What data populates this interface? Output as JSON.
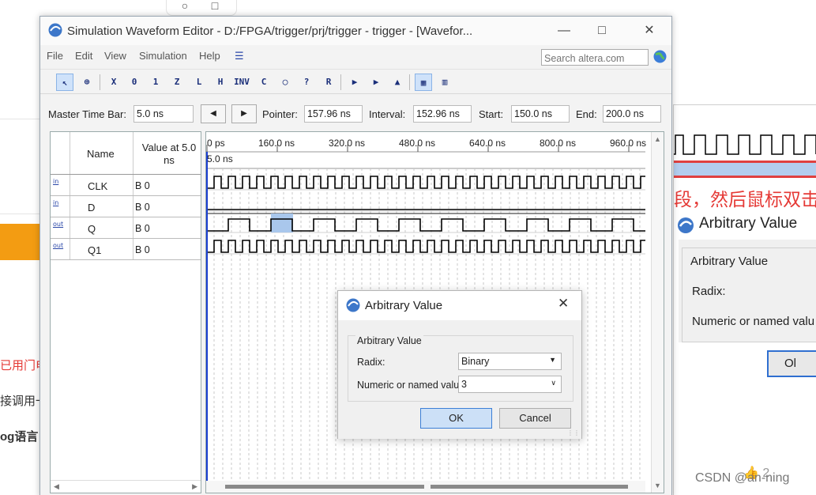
{
  "background": {
    "texts": [
      {
        "text": "已用门电",
        "red": true,
        "bold": false
      },
      {
        "text": "接调用一",
        "red": false,
        "bold": false
      },
      {
        "text": "og语言",
        "red": false,
        "bold": true
      }
    ],
    "right_window": {
      "cn_text": "段，然后鼠标双击",
      "dialog_title": "Arbitrary Value",
      "group_title": "Arbitrary Value",
      "radix_label": "Radix:",
      "value_label": "Numeric or named valu",
      "ok_partial": "Ol",
      "thumb_count": "2"
    },
    "watermark": "CSDN @an-ning"
  },
  "window": {
    "title": "Simulation Waveform Editor - D:/FPGA/trigger/prj/trigger - trigger - [Wavefor...",
    "menu": [
      "File",
      "Edit",
      "View",
      "Simulation",
      "Help"
    ],
    "search_placeholder": "Search altera.com"
  },
  "timebar": {
    "master_label": "Master Time Bar:",
    "master_value": "5.0 ns",
    "pointer_label": "Pointer:",
    "pointer_value": "157.96 ns",
    "interval_label": "Interval:",
    "interval_value": "152.96 ns",
    "start_label": "Start:",
    "start_value": "150.0 ns",
    "end_label": "End:",
    "end_value": "200.0 ns"
  },
  "signals": {
    "header_name": "Name",
    "header_value": "Value at 5.0 ns",
    "rows": [
      {
        "dir": "in",
        "name": "CLK",
        "value": "B 0"
      },
      {
        "dir": "in",
        "name": "D",
        "value": "B 0"
      },
      {
        "dir": "out",
        "name": "Q",
        "value": "B 0"
      },
      {
        "dir": "out",
        "name": "Q1",
        "value": "B 0"
      }
    ]
  },
  "waveform": {
    "time_ticks": [
      "0 ps",
      "160.0 ns",
      "320.0 ns",
      "480.0 ns",
      "640.0 ns",
      "800.0 ns",
      "960.0 ns"
    ],
    "cursor_label": "5.0 ns"
  },
  "dialog": {
    "title": "Arbitrary Value",
    "group_title": "Arbitrary Value",
    "radix_label": "Radix:",
    "radix_value": "Binary",
    "value_label": "Numeric or named value:",
    "value_value": "3",
    "ok_label": "OK",
    "cancel_label": "Cancel"
  }
}
